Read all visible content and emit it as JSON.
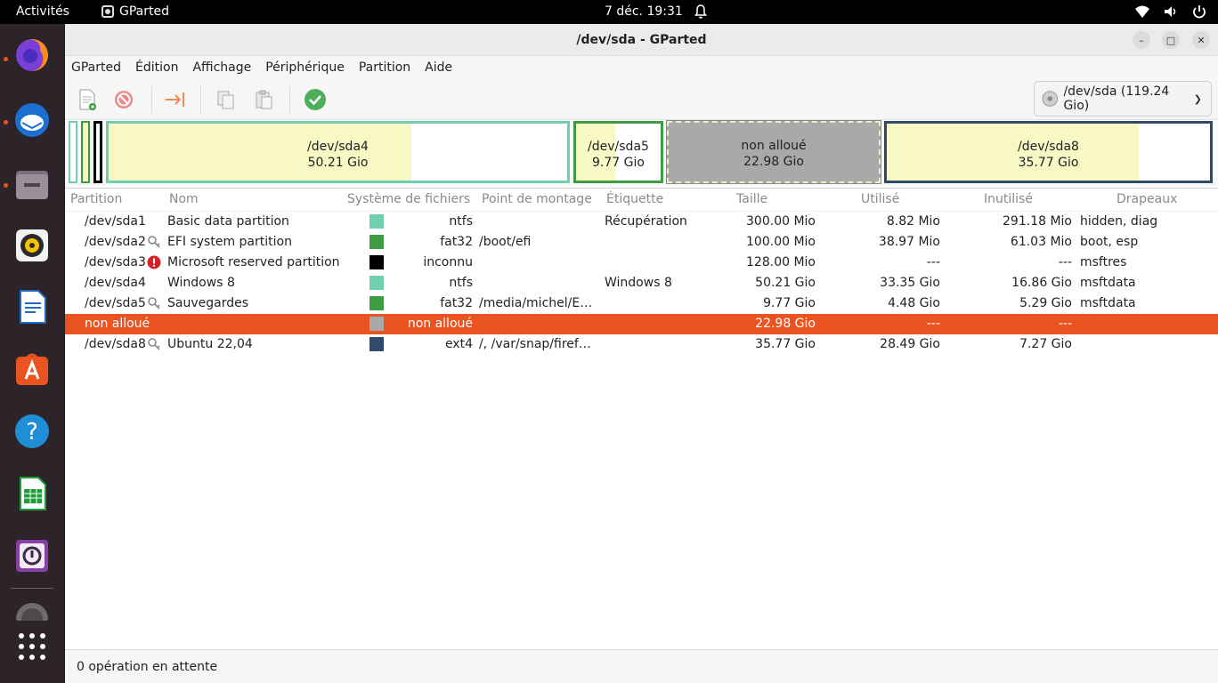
{
  "topbar": {
    "activities": "Activités",
    "app_name": "GParted",
    "clock": "7 déc.  19:31"
  },
  "window": {
    "title": "/dev/sda - GParted"
  },
  "menu": [
    "GParted",
    "Édition",
    "Affichage",
    "Périphérique",
    "Partition",
    "Aide"
  ],
  "device_selector": {
    "label": "/dev/sda (119.24 Gio)"
  },
  "partition_bar": [
    {
      "name": "/dev/sda4",
      "size": "50.21 Gio",
      "used_fraction": 0.66
    },
    {
      "name": "/dev/sda5",
      "size": "9.77 Gio",
      "used_fraction": 0.46
    },
    {
      "name": "non alloué",
      "size": "22.98 Gio",
      "used_fraction": 0
    },
    {
      "name": "/dev/sda8",
      "size": "35.77 Gio",
      "used_fraction": 0.78
    }
  ],
  "table": {
    "headers": [
      "Partition",
      "Nom",
      "Système de fichiers",
      "Point de montage",
      "Étiquette",
      "Taille",
      "Utilisé",
      "Inutilisé",
      "Drapeaux"
    ],
    "rows": [
      {
        "partition": "/dev/sda1",
        "name": "Basic data partition",
        "fs": "ntfs",
        "fs_color": "#6fcfb0",
        "mount": "",
        "label": "Récupération",
        "size": "300.00 Mio",
        "used": "8.82 Mio",
        "unused": "291.18 Mio",
        "flags": "hidden, diag",
        "icon": ""
      },
      {
        "partition": "/dev/sda2",
        "name": "EFI system partition",
        "fs": "fat32",
        "fs_color": "#3e9c44",
        "mount": "/boot/efi",
        "label": "",
        "size": "100.00 Mio",
        "used": "38.97 Mio",
        "unused": "61.03 Mio",
        "flags": "boot, esp",
        "icon": "key-icon"
      },
      {
        "partition": "/dev/sda3",
        "name": "Microsoft reserved partition",
        "fs": "inconnu",
        "fs_color": "#000000",
        "mount": "",
        "label": "",
        "size": "128.00 Mio",
        "used": "---",
        "unused": "---",
        "flags": "msftres",
        "icon": "warning-icon"
      },
      {
        "partition": "/dev/sda4",
        "name": "Windows 8",
        "fs": "ntfs",
        "fs_color": "#6fcfb0",
        "mount": "",
        "label": "Windows 8",
        "size": "50.21 Gio",
        "used": "33.35 Gio",
        "unused": "16.86 Gio",
        "flags": "msftdata",
        "icon": ""
      },
      {
        "partition": "/dev/sda5",
        "name": "Sauvegardes",
        "fs": "fat32",
        "fs_color": "#3e9c44",
        "mount": "/media/michel/E…",
        "label": "",
        "size": "9.77 Gio",
        "used": "4.48 Gio",
        "unused": "5.29 Gio",
        "flags": "msftdata",
        "icon": "key-icon"
      },
      {
        "partition": "non alloué",
        "name": "",
        "fs": "non alloué",
        "fs_color": "#a9a9a9",
        "mount": "",
        "label": "",
        "size": "22.98 Gio",
        "used": "---",
        "unused": "---",
        "flags": "",
        "icon": "",
        "selected": true
      },
      {
        "partition": "/dev/sda8",
        "name": "Ubuntu 22,04",
        "fs": "ext4",
        "fs_color": "#2f4a6b",
        "mount": "/, /var/snap/firef…",
        "label": "",
        "size": "35.77 Gio",
        "used": "28.49 Gio",
        "unused": "7.27 Gio",
        "flags": "",
        "icon": "key-icon"
      }
    ]
  },
  "status": {
    "text": "0 opération en attente"
  },
  "colors": {
    "accent": "#e95420",
    "ntfs": "#6fcfb0",
    "fat32": "#3e9c44",
    "ext4": "#2f4a6b",
    "unallocated": "#a9a9a9",
    "used_fill": "#f8f8c4"
  }
}
